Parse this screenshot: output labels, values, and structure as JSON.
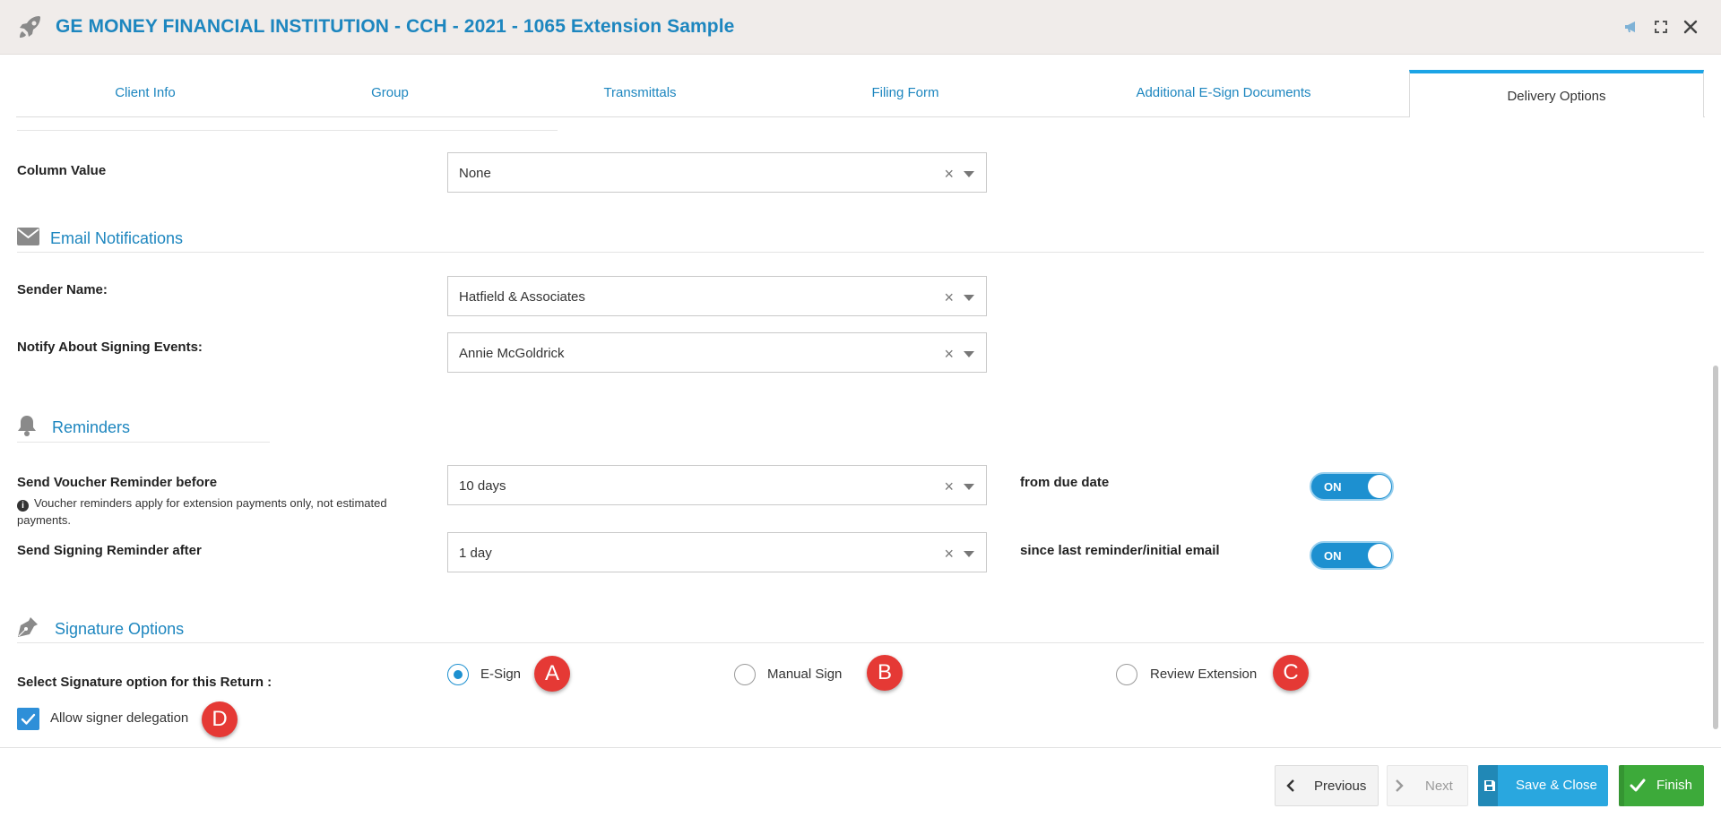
{
  "window": {
    "title": "GE MONEY FINANCIAL INSTITUTION - CCH - 2021 - 1065 Extension Sample",
    "controls": [
      "megaphone-icon",
      "expand-icon",
      "close-icon"
    ]
  },
  "tabs": [
    {
      "label": "Client Info",
      "active": false
    },
    {
      "label": "Group",
      "active": false
    },
    {
      "label": "Transmittals",
      "active": false
    },
    {
      "label": "Filing Form",
      "active": false
    },
    {
      "label": "Additional E-Sign Documents",
      "active": false
    },
    {
      "label": "Delivery Options",
      "active": true
    }
  ],
  "column_value": {
    "label": "Column Value",
    "value": "None"
  },
  "email_notifications": {
    "title": "Email Notifications",
    "sender_name": {
      "label": "Sender Name:",
      "value": "Hatfield & Associates"
    },
    "notify": {
      "label": "Notify About Signing Events:",
      "value": "Annie McGoldrick"
    }
  },
  "reminders": {
    "title": "Reminders",
    "voucher": {
      "label": "Send Voucher Reminder before",
      "hint": "Voucher reminders apply for extension payments only, not estimated payments.",
      "value": "10 days",
      "suffix": "from due date",
      "toggle": "ON"
    },
    "signing": {
      "label": "Send Signing Reminder after",
      "value": "1 day",
      "suffix": "since last reminder/initial email",
      "toggle": "ON"
    }
  },
  "signature": {
    "title": "Signature Options",
    "label": "Select Signature option for this Return :",
    "options": [
      {
        "label": "E-Sign",
        "selected": true,
        "badge": "A"
      },
      {
        "label": "Manual Sign",
        "selected": false,
        "badge": "B"
      },
      {
        "label": "Review Extension",
        "selected": false,
        "badge": "C"
      }
    ],
    "delegation": {
      "label": "Allow signer delegation",
      "checked": true,
      "badge": "D"
    }
  },
  "footer": {
    "previous": "Previous",
    "next": "Next",
    "save_close": "Save & Close",
    "finish": "Finish"
  },
  "colors": {
    "accent": "#1d86bf",
    "tab_active_border": "#1ca4e6",
    "badge": "#e53935",
    "finish": "#3daa3a",
    "save": "#29a7df"
  }
}
